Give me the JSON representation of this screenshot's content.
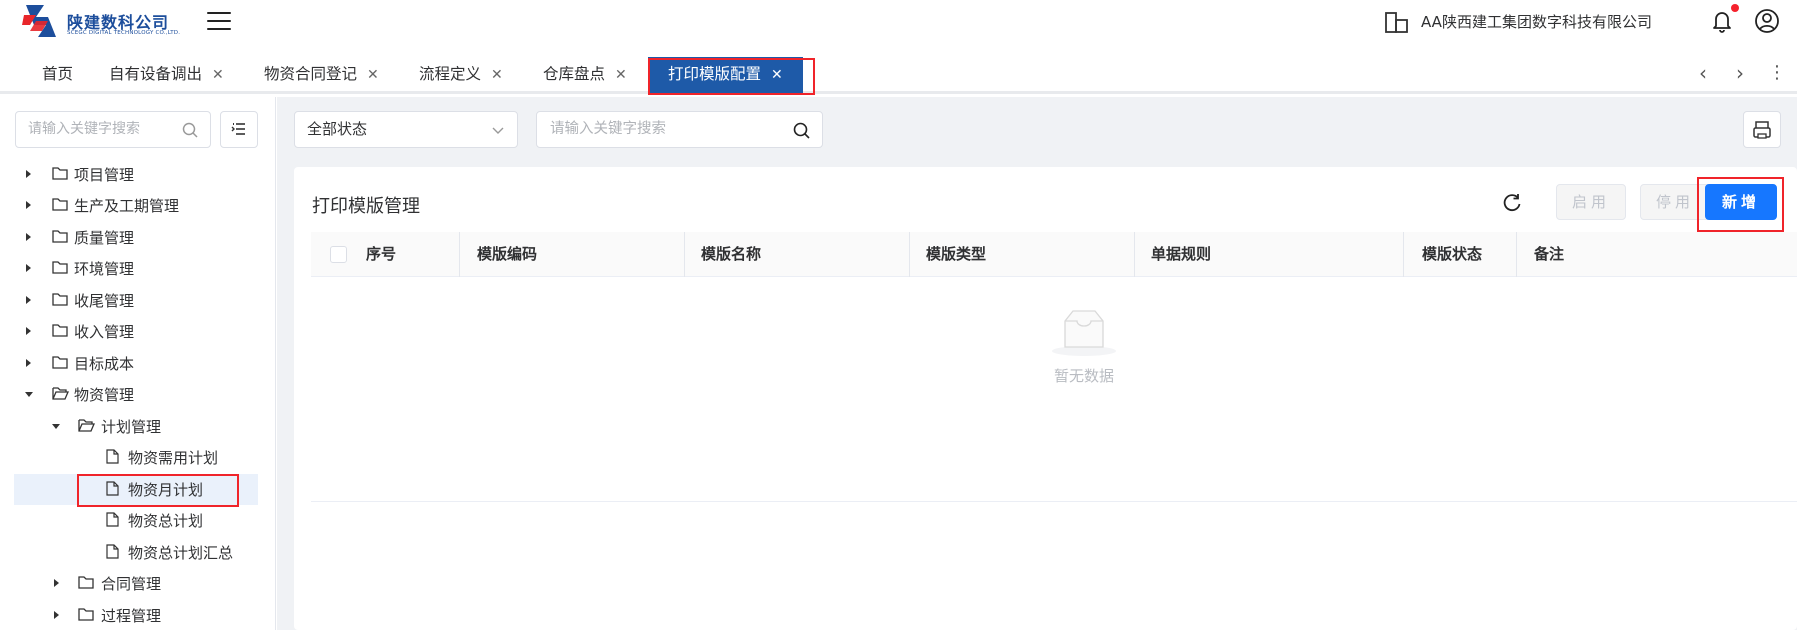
{
  "header": {
    "logo_title": "陕建数科公司",
    "logo_subtitle": "SCEGC DIGITAL TECHNOLOGY CO.,LTD.",
    "org_name": "AA陕西建工集团数字科技有限公司"
  },
  "tabs": [
    {
      "label": "首页",
      "closable": false
    },
    {
      "label": "自有设备调出",
      "closable": true
    },
    {
      "label": "物资合同登记",
      "closable": true
    },
    {
      "label": "流程定义",
      "closable": true
    },
    {
      "label": "仓库盘点",
      "closable": true
    },
    {
      "label": "打印模版配置",
      "closable": true,
      "active": true
    }
  ],
  "tree": {
    "search_placeholder": "请输入关键字搜索",
    "items": [
      {
        "label": "项目管理",
        "level": 0,
        "type": "folder",
        "expanded": false
      },
      {
        "label": "生产及工期管理",
        "level": 0,
        "type": "folder",
        "expanded": false
      },
      {
        "label": "质量管理",
        "level": 0,
        "type": "folder",
        "expanded": false
      },
      {
        "label": "环境管理",
        "level": 0,
        "type": "folder",
        "expanded": false
      },
      {
        "label": "收尾管理",
        "level": 0,
        "type": "folder",
        "expanded": false
      },
      {
        "label": "收入管理",
        "level": 0,
        "type": "folder",
        "expanded": false
      },
      {
        "label": "目标成本",
        "level": 0,
        "type": "folder",
        "expanded": false
      },
      {
        "label": "物资管理",
        "level": 0,
        "type": "folder",
        "expanded": true
      },
      {
        "label": "计划管理",
        "level": 1,
        "type": "folder",
        "expanded": true
      },
      {
        "label": "物资需用计划",
        "level": 2,
        "type": "file"
      },
      {
        "label": "物资月计划",
        "level": 2,
        "type": "file",
        "selected": true
      },
      {
        "label": "物资总计划",
        "level": 2,
        "type": "file"
      },
      {
        "label": "物资总计划汇总",
        "level": 2,
        "type": "file"
      },
      {
        "label": "合同管理",
        "level": 1,
        "type": "folder",
        "expanded": false
      },
      {
        "label": "过程管理",
        "level": 1,
        "type": "folder",
        "expanded": false
      }
    ]
  },
  "filters": {
    "status_value": "全部状态",
    "search_placeholder": "请输入关键字搜索"
  },
  "card": {
    "title": "打印模版管理",
    "enable_label": "启用",
    "disable_label": "停用",
    "add_label": "新增"
  },
  "table": {
    "columns": [
      "序号",
      "模版编码",
      "模版名称",
      "模版类型",
      "单据规则",
      "模版状态",
      "备注"
    ],
    "rows": [],
    "empty_text": "暂无数据"
  },
  "colors": {
    "active_tab": "#1e5aa8",
    "primary_button": "#1677ff",
    "highlight_box": "#f0242a",
    "notification_dot": "#f5222d"
  }
}
